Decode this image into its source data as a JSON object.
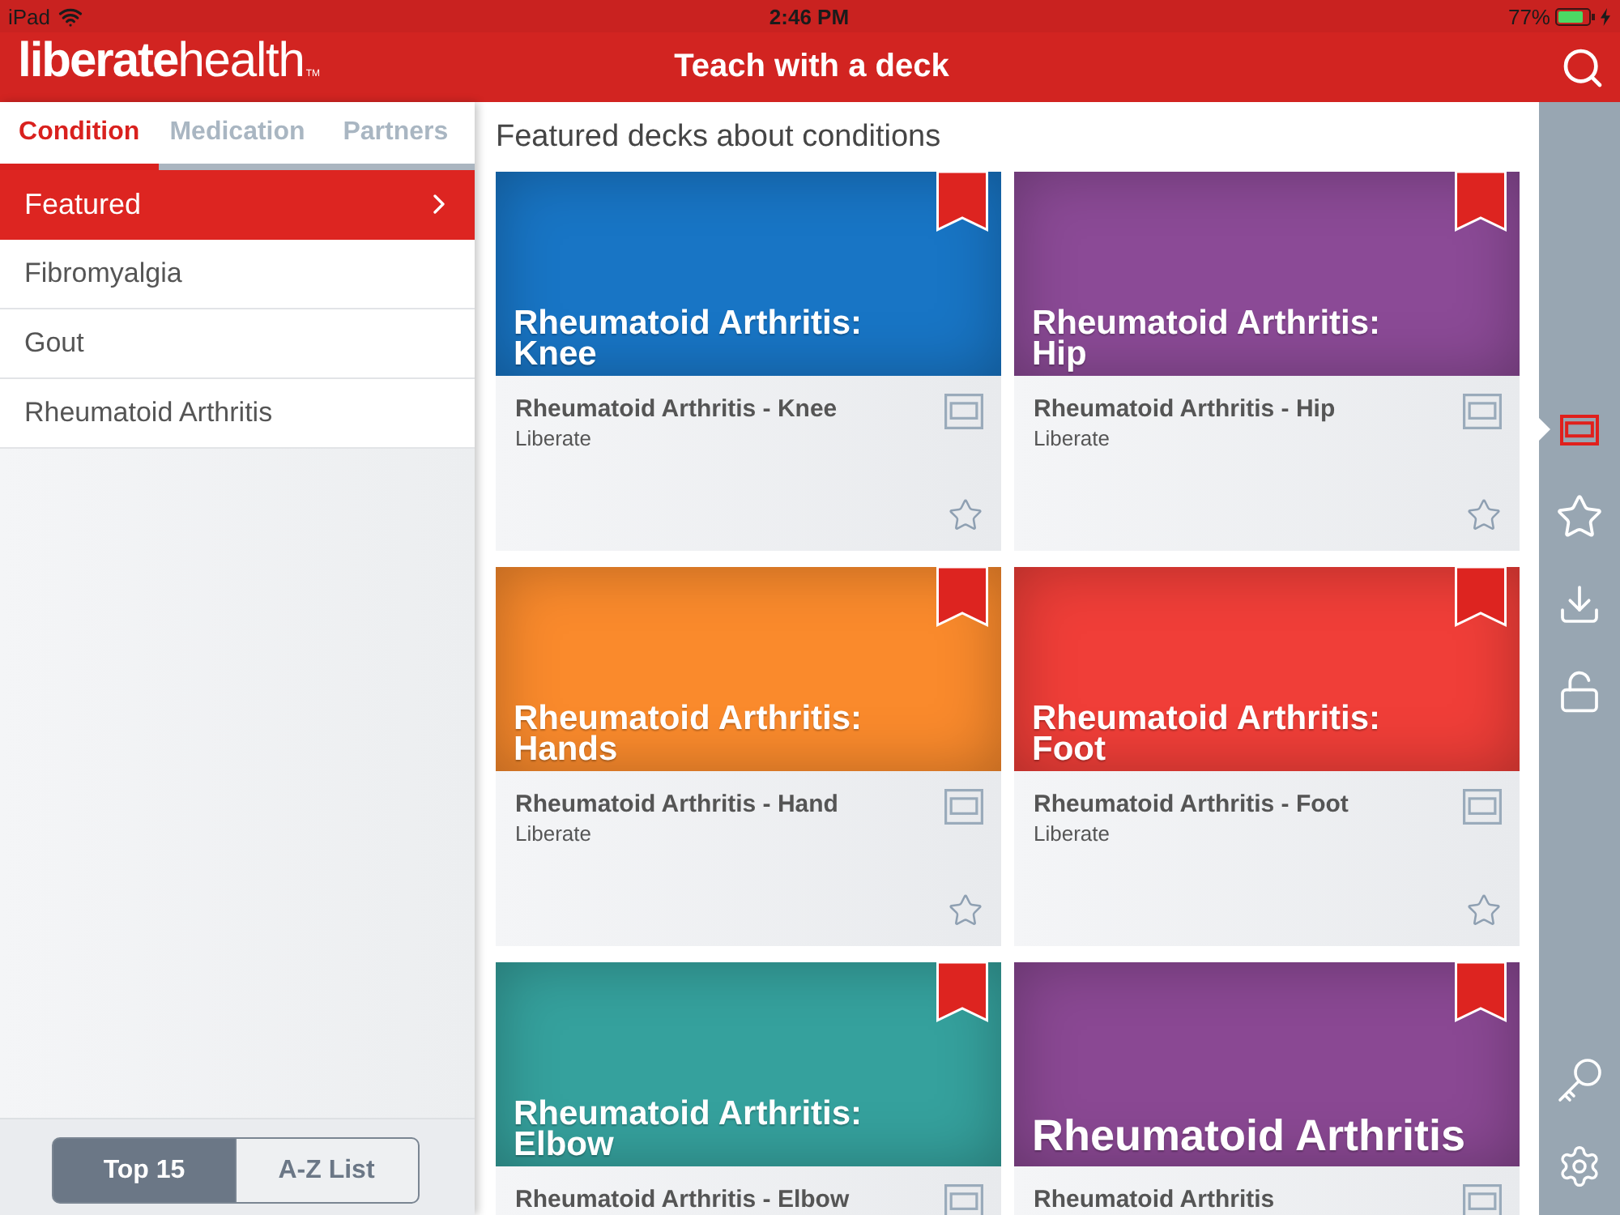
{
  "status_bar": {
    "carrier": "iPad",
    "time": "2:46 PM",
    "battery": "77%"
  },
  "header": {
    "logo": "**liberate**health$_{TM}$",
    "title": "Teach with a deck"
  },
  "sidebar": {
    "tabs": [
      {
        "label": "Condition",
        "selected": true
      },
      {
        "label": "Medication",
        "selected": false
      },
      {
        "label": "Partners",
        "selected": false
      }
    ],
    "items": [
      {
        "label": "Featured",
        "selected": true
      },
      {
        "label": "Fibromyalgia",
        "selected": false
      },
      {
        "label": "Gout",
        "selected": false
      },
      {
        "label": "Rheumatoid Arthritis",
        "selected": false
      }
    ],
    "view_toggle": [
      {
        "label": "Top 15",
        "selected": true
      },
      {
        "label": "A-Z List",
        "selected": false
      }
    ]
  },
  "content": {
    "heading": "Featured decks about conditions",
    "decks": [
      {
        "cover_title": "Rheumatoid Arthritis: Knee",
        "color": "#1875c5",
        "bookmarked": true,
        "title": "Rheumatoid Arthritis - Knee",
        "author": "Liberate",
        "favorite": false
      },
      {
        "cover_title": "Rheumatoid Arthritis: Hip",
        "color": "#8b4a96",
        "bookmarked": true,
        "title": "Rheumatoid Arthritis - Hip",
        "author": "Liberate",
        "favorite": false
      },
      {
        "cover_title": "Rheumatoid Arthritis: Hands",
        "color": "#fa8a2c",
        "bookmarked": true,
        "title": "Rheumatoid Arthritis - Hand",
        "author": "Liberate",
        "favorite": false
      },
      {
        "cover_title": "Rheumatoid Arthritis: Foot",
        "color": "#f03e38",
        "bookmarked": true,
        "title": "Rheumatoid Arthritis - Foot",
        "author": "Liberate",
        "favorite": false
      },
      {
        "cover_title": "Rheumatoid Arthritis: Elbow",
        "color": "#35a19d",
        "bookmarked": true,
        "title": "Rheumatoid Arthritis - Elbow"
      },
      {
        "cover_title": "Rheumatoid Arthritis",
        "color": "#8a4893",
        "bookmarked": true,
        "title": "Rheumatoid Arthritis"
      }
    ]
  },
  "rail": {
    "items": [
      {
        "selected": true
      },
      {
        "selected": false
      },
      {
        "selected": false
      },
      {
        "selected": false
      }
    ]
  }
}
